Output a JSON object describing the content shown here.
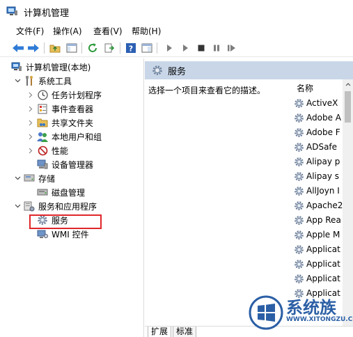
{
  "window": {
    "title": "计算机管理"
  },
  "menu": [
    {
      "label": "文件(F)"
    },
    {
      "label": "操作(A)"
    },
    {
      "label": "查看(V)"
    },
    {
      "label": "帮助(H)"
    }
  ],
  "toolbar": [
    {
      "icon": "back-arrow-icon"
    },
    {
      "icon": "forward-arrow-icon"
    },
    {
      "icon": "up-folder-icon"
    },
    {
      "icon": "show-hide-console-tree-icon"
    },
    {
      "icon": "refresh-icon"
    },
    {
      "icon": "export-list-icon"
    },
    {
      "icon": "help-icon"
    },
    {
      "icon": "properties-icon"
    },
    {
      "icon": "start-service-icon"
    },
    {
      "icon": "start-service-alt-icon"
    },
    {
      "icon": "stop-service-icon"
    },
    {
      "icon": "pause-service-icon"
    },
    {
      "icon": "restart-service-icon"
    }
  ],
  "tree": {
    "root": "计算机管理(本地)",
    "system_tools": "系统工具",
    "task_scheduler": "任务计划程序",
    "event_viewer": "事件查看器",
    "shared_folders": "共享文件夹",
    "local_users": "本地用户和组",
    "performance": "性能",
    "device_manager": "设备管理器",
    "storage": "存储",
    "disk_management": "磁盘管理",
    "services_apps": "服务和应用程序",
    "services": "服务",
    "wmi": "WMI 控件"
  },
  "content": {
    "header_title": "服务",
    "description": "选择一个项目来查看它的描述。",
    "column_name": "名称",
    "services": [
      "ActiveX",
      "Adobe A",
      "Adobe F",
      "ADSafe",
      "Alipay p",
      "Alipay s",
      "AllJoyn I",
      "Apache2",
      "App Rea",
      "Apple M",
      "Applicat",
      "Applicat",
      "Applicat",
      "Applicat"
    ],
    "tabs": [
      {
        "label": "扩展"
      },
      {
        "label": "标准"
      }
    ]
  },
  "watermark": {
    "text": "系统族",
    "url": "WWW.XITONGZU.COM"
  },
  "colors": {
    "header_bg": "#c8d6e8",
    "highlight_border": "#e0262a",
    "watermark_blue": "#2b5fa5"
  }
}
